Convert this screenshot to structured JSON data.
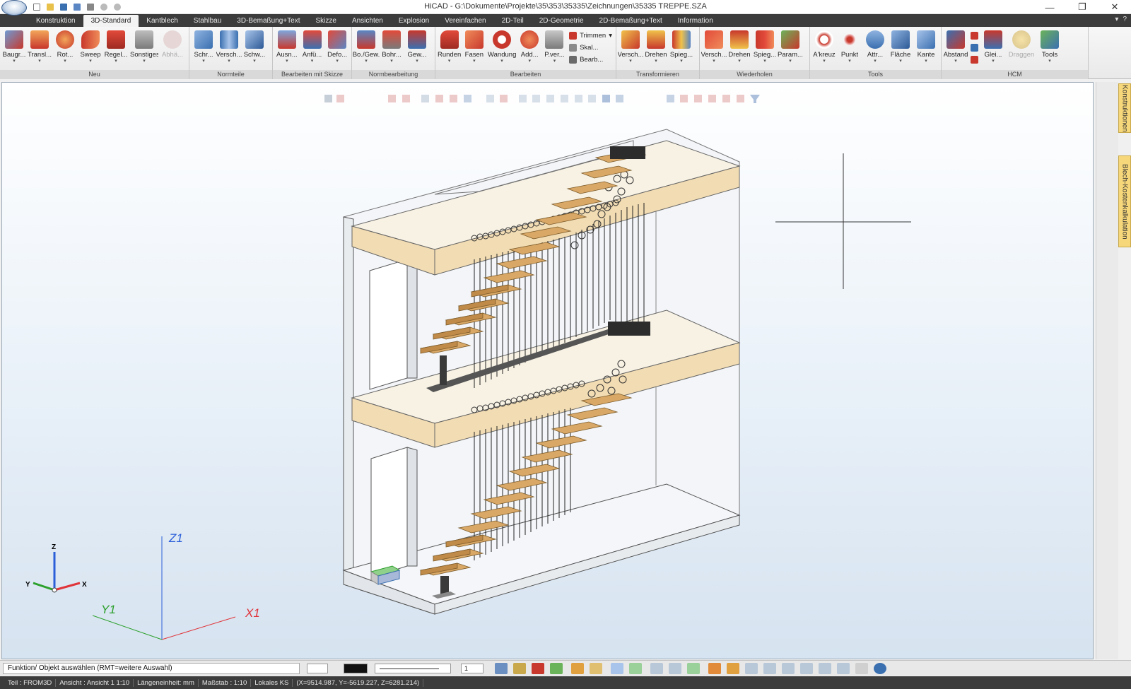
{
  "window": {
    "title": "HiCAD - G:\\Dokumente\\Projekte\\35\\353\\35335\\Zeichnungen\\35335 TREPPE.SZA",
    "minimize": "—",
    "restore": "❐",
    "close": "✕"
  },
  "tabs": [
    {
      "label": "Konstruktion"
    },
    {
      "label": "3D-Standard"
    },
    {
      "label": "Kantblech"
    },
    {
      "label": "Stahlbau"
    },
    {
      "label": "3D-Bemaßung+Text"
    },
    {
      "label": "Skizze"
    },
    {
      "label": "Ansichten"
    },
    {
      "label": "Explosion"
    },
    {
      "label": "Vereinfachen"
    },
    {
      "label": "2D-Teil"
    },
    {
      "label": "2D-Geometrie"
    },
    {
      "label": "2D-Bemaßung+Text"
    },
    {
      "label": "Information"
    }
  ],
  "active_tab": "3D-Standard",
  "ribbon": {
    "neu": {
      "label": "Neu",
      "buttons": [
        "Baugr...",
        "Transl...",
        "Rot...",
        "Sweep",
        "Regel...",
        "Sonstiges",
        "Abhä..."
      ]
    },
    "normteile": {
      "label": "Normteile",
      "buttons": [
        "Schr...",
        "Versch...",
        "Schw..."
      ]
    },
    "skizze": {
      "label": "Bearbeiten mit Skizze",
      "buttons": [
        "Ausn...",
        "Anfü...",
        "Defo..."
      ]
    },
    "normbearbeitung": {
      "label": "Normbearbeitung",
      "buttons": [
        "Bo./Gew.",
        "Bohr...",
        "Gew..."
      ]
    },
    "bearbeiten": {
      "label": "Bearbeiten",
      "buttons": [
        "Runden",
        "Fasen",
        "Wandung",
        "Add...",
        "P.ver..."
      ],
      "small": [
        "Trimmen",
        "Skal...",
        "Bearb..."
      ]
    },
    "transformieren": {
      "label": "Transformieren",
      "buttons": [
        "Versch...",
        "Drehen",
        "Spieg..."
      ]
    },
    "wiederholen": {
      "label": "Wiederholen",
      "buttons": [
        "Versch...",
        "Drehen",
        "Spieg...",
        "Param..."
      ]
    },
    "tools": {
      "label": "Tools",
      "buttons": [
        "A'kreuz",
        "Punkt",
        "Attr...",
        "Fläche",
        "Kante"
      ]
    },
    "hcm": {
      "label": "HCM",
      "buttons": [
        "Abstand",
        "Glei...",
        "Draggen",
        "Tools"
      ]
    }
  },
  "viewport": {
    "axes_world": {
      "z": "Z1",
      "x": "X1",
      "y": "Y1"
    },
    "axes_local": {
      "z": "Z",
      "x": "X",
      "y": "Y"
    }
  },
  "side_tabs": {
    "konstruktionen": "Konstruktionen",
    "blech": "Blech-Kostenkalkulation"
  },
  "command": {
    "prompt": "Funktion/ Objekt auswählen (RMT=weitere Auswahl)",
    "linewidth": "1"
  },
  "status": {
    "teil": "Teil : FROM3D",
    "ansicht": "Ansicht : Ansicht 1 1:10",
    "einheit": "Längeneinheit: mm",
    "massstab": "Maßstab : 1:10",
    "ks": "Lokales KS",
    "coords": "(X=9514.987, Y=-5619.227, Z=6281.214)"
  },
  "colors": {
    "accent_red": "#c8382c",
    "accent_blue": "#3a6fb0",
    "wood": "#f2dcb3",
    "tread": "#d9a866",
    "axis_x": "#e0343a",
    "axis_y": "#2ca02c",
    "axis_z": "#2b5fd9"
  }
}
